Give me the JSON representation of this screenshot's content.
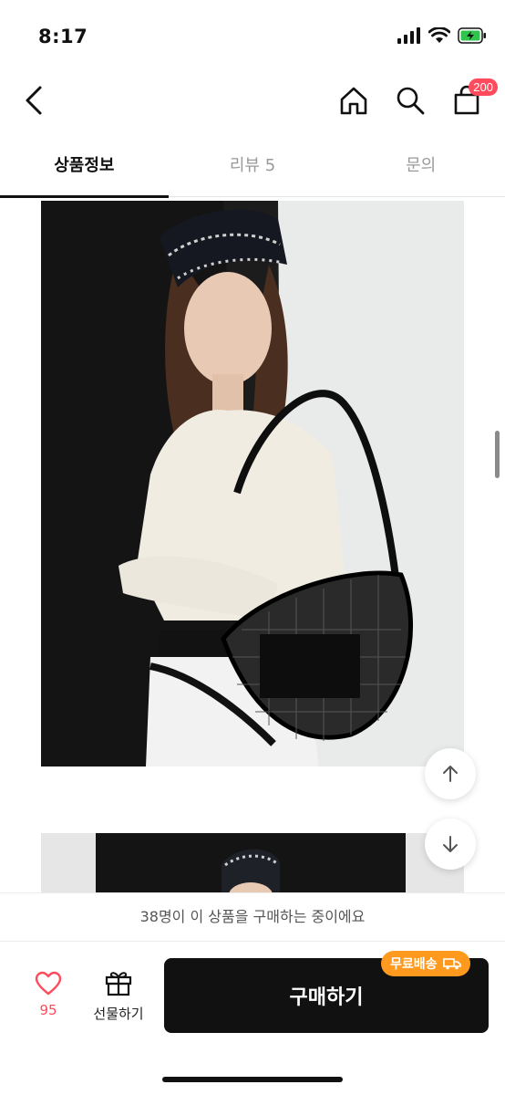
{
  "status_bar": {
    "time": "8:17"
  },
  "header": {
    "cart_badge": "200"
  },
  "tabs": [
    {
      "label": "상품정보",
      "active": true
    },
    {
      "label": "리뷰 5",
      "active": false
    },
    {
      "label": "문의",
      "active": false
    }
  ],
  "notice": {
    "text": "38명이 이 상품을 구매하는 중이에요"
  },
  "bottom_bar": {
    "like_count": "95",
    "gift_label": "선물하기",
    "buy_label": "구매하기",
    "free_shipping_label": "무료배송"
  },
  "colors": {
    "accent": "#ff4b5c",
    "buy_button": "#111111",
    "free_shipping": "#ff9a1f"
  }
}
